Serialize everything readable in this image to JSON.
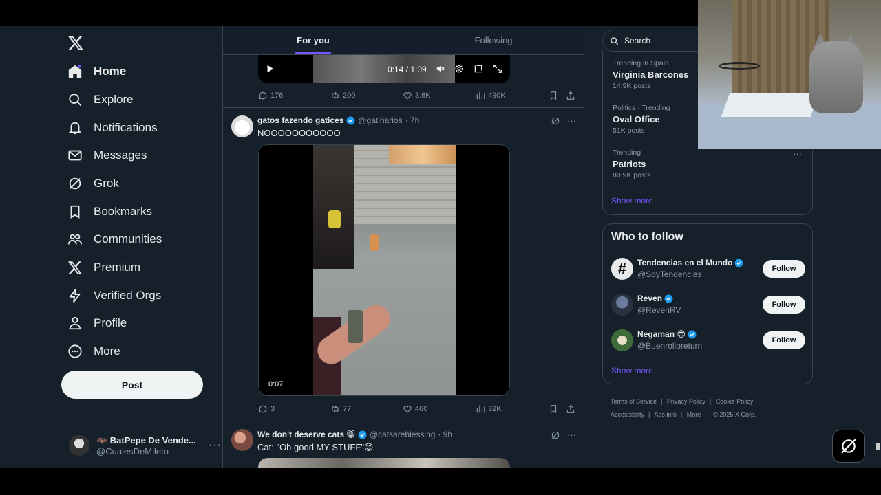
{
  "nav": {
    "items": [
      {
        "label": "Home",
        "icon": "home-icon"
      },
      {
        "label": "Explore",
        "icon": "search-icon"
      },
      {
        "label": "Notifications",
        "icon": "bell-icon"
      },
      {
        "label": "Messages",
        "icon": "envelope-icon"
      },
      {
        "label": "Grok",
        "icon": "grok-icon"
      },
      {
        "label": "Bookmarks",
        "icon": "bookmark-icon"
      },
      {
        "label": "Communities",
        "icon": "communities-icon"
      },
      {
        "label": "Premium",
        "icon": "x-logo-icon"
      },
      {
        "label": "Verified Orgs",
        "icon": "lightning-icon"
      },
      {
        "label": "Profile",
        "icon": "person-icon"
      },
      {
        "label": "More",
        "icon": "more-circle-icon"
      }
    ],
    "post_label": "Post"
  },
  "account": {
    "name": "🦇 BatPepe De Vende...",
    "handle": "@CualesDeMileto"
  },
  "tabs": {
    "for_you": "For you",
    "following": "Following"
  },
  "tweet1": {
    "video_time": "0:14 / 1:09",
    "stats": {
      "replies": "176",
      "reposts": "200",
      "likes": "3.6K",
      "views": "490K"
    }
  },
  "tweet2": {
    "name": "gatos fazendo gatices",
    "handle": "@gatinarios",
    "time": "· 7h",
    "text": "NOOOOOOOOOOO",
    "video_time": "0:07",
    "stats": {
      "replies": "3",
      "reposts": "77",
      "likes": "460",
      "views": "32K"
    }
  },
  "tweet3": {
    "name": "We don't deserve cats 😸",
    "handle": "@catsareblessing",
    "time": "· 9h",
    "text": "Cat: \"Oh good MY STUFF\"😊"
  },
  "search": {
    "placeholder": "Search"
  },
  "trends": [
    {
      "meta": "Trending in Spain",
      "title": "Virginia Barcones",
      "count": "14.9K posts"
    },
    {
      "meta": "Politics · Trending",
      "title": "Oval Office",
      "count": "51K posts"
    },
    {
      "meta": "Trending",
      "title": "Patriots",
      "count": "80.9K posts"
    }
  ],
  "trends_show_more": "Show more",
  "who_to_follow": {
    "title": "Who to follow",
    "accounts": [
      {
        "name": "Tendencias en el Mundo",
        "handle": "@SoyTendencias",
        "button": "Follow"
      },
      {
        "name": "Reven",
        "handle": "@RevenRV",
        "button": "Follow"
      },
      {
        "name": "Negaman 😎",
        "handle": "@Buenrolloreturn",
        "button": "Follow"
      }
    ],
    "show_more": "Show more"
  },
  "footer": {
    "links": [
      "Terms of Service",
      "Privacy Policy",
      "Cookie Policy",
      "Accessibility",
      "Ads info",
      "More ···"
    ],
    "copyright": "© 2025 X Corp."
  },
  "colors": {
    "background": "#15202b",
    "accent": "#7856ff",
    "verified": "#1d9bf0",
    "border": "#38444d"
  }
}
